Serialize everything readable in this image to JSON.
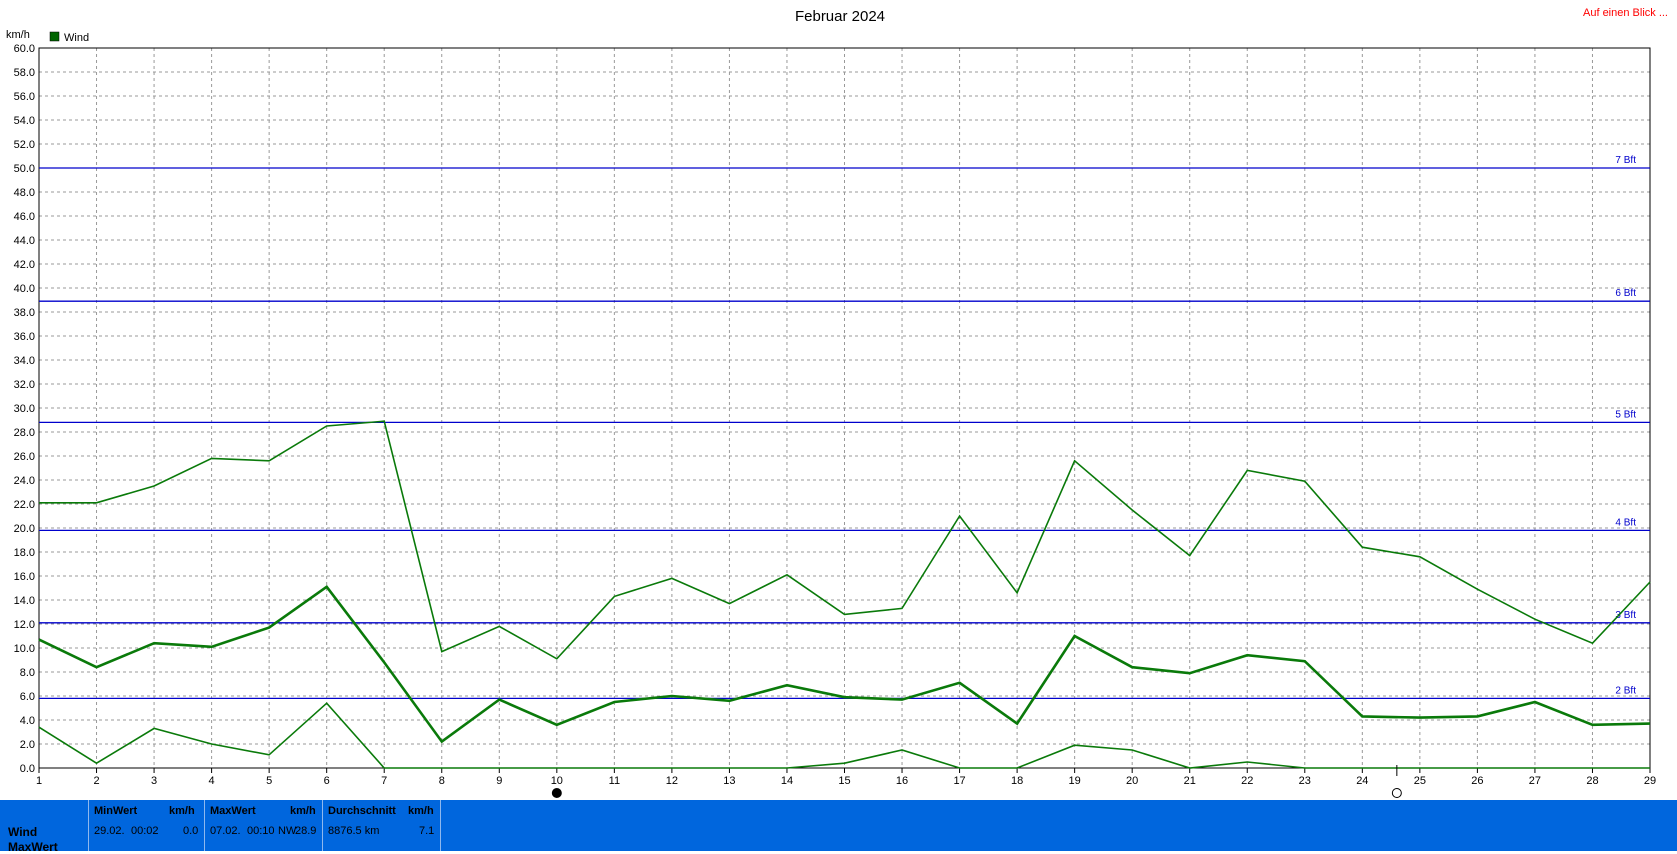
{
  "header": {
    "title": "Februar 2024",
    "link": "Auf einen Blick ...",
    "unit": "km/h",
    "legend_label": "Wind",
    "legend_color": "#006400"
  },
  "chart_data": {
    "type": "line",
    "title": "Februar 2024",
    "ylabel": "km/h",
    "ylim": [
      0,
      60
    ],
    "y_ticks": [
      "0.0",
      "2.0",
      "4.0",
      "6.0",
      "8.0",
      "10.0",
      "12.0",
      "14.0",
      "16.0",
      "18.0",
      "20.0",
      "22.0",
      "24.0",
      "26.0",
      "28.0",
      "30.0",
      "32.0",
      "34.0",
      "36.0",
      "38.0",
      "40.0",
      "42.0",
      "44.0",
      "46.0",
      "48.0",
      "50.0",
      "52.0",
      "54.0",
      "56.0",
      "58.0",
      "60.0"
    ],
    "x": [
      1,
      2,
      3,
      4,
      5,
      6,
      7,
      8,
      9,
      10,
      11,
      12,
      13,
      14,
      15,
      16,
      17,
      18,
      19,
      20,
      21,
      22,
      23,
      24,
      25,
      26,
      27,
      28,
      29
    ],
    "grid": true,
    "legend": "top-left",
    "series": [
      {
        "name": "Wind",
        "role": "max",
        "color": "#0a7a0a",
        "width": 1.6,
        "values": [
          22.1,
          22.1,
          23.5,
          25.8,
          25.6,
          28.5,
          28.9,
          9.7,
          11.8,
          9.1,
          14.3,
          15.8,
          13.7,
          16.1,
          12.8,
          13.3,
          21.0,
          14.6,
          25.6,
          21.5,
          17.7,
          24.8,
          23.9,
          18.4,
          17.6,
          14.9,
          12.4,
          10.4,
          15.5
        ]
      },
      {
        "name": "Wind",
        "role": "avg",
        "color": "#0a7a0a",
        "width": 2.6,
        "values": [
          10.7,
          8.4,
          10.4,
          10.1,
          11.7,
          15.1,
          8.8,
          2.2,
          5.7,
          3.6,
          5.5,
          6.0,
          5.6,
          6.9,
          5.9,
          5.7,
          7.1,
          3.7,
          11.0,
          8.4,
          7.9,
          9.4,
          8.9,
          4.3,
          4.2,
          4.3,
          5.5,
          3.6,
          3.7
        ]
      },
      {
        "name": "Wind",
        "role": "min",
        "color": "#0a7a0a",
        "width": 1.6,
        "values": [
          3.4,
          0.4,
          3.3,
          2.0,
          1.1,
          5.4,
          0.0,
          0.0,
          0.0,
          0.0,
          0.0,
          0.0,
          0.0,
          0.0,
          0.4,
          1.5,
          0.0,
          0.0,
          1.9,
          1.5,
          0.0,
          0.5,
          0.0,
          0.0,
          0.0,
          0.0,
          0.0,
          0.0,
          0.0
        ]
      }
    ],
    "beaufort_lines": [
      {
        "label": "2 Bft",
        "value": 5.8,
        "color": "#0000cc"
      },
      {
        "label": "3 Bft",
        "value": 12.1,
        "color": "#0000cc"
      },
      {
        "label": "4 Bft",
        "value": 19.8,
        "color": "#0000cc"
      },
      {
        "label": "5 Bft",
        "value": 28.8,
        "color": "#0000cc"
      },
      {
        "label": "6 Bft",
        "value": 38.9,
        "color": "#0000cc"
      },
      {
        "label": "7 Bft",
        "value": 50.0,
        "color": "#0000cc"
      }
    ],
    "moon_phases": [
      {
        "day": 10,
        "phase": "new-moon"
      },
      {
        "day": 24.6,
        "phase": "full-moon"
      }
    ]
  },
  "summary": {
    "rows": [
      "Wind",
      "MaxWert"
    ],
    "min": {
      "label": "MinWert",
      "unit": "km/h",
      "date": "29.02.",
      "time": "00:02",
      "value": "0.0"
    },
    "max": {
      "label": "MaxWert",
      "unit": "km/h",
      "date": "07.02.",
      "time": "00:10",
      "dir": "NW",
      "value": "28.9"
    },
    "avg": {
      "label": "Durchschnitt",
      "unit": "km/h",
      "distance": "8876.5 km",
      "value": "7.1"
    },
    "bar_color": "#0066dd"
  }
}
